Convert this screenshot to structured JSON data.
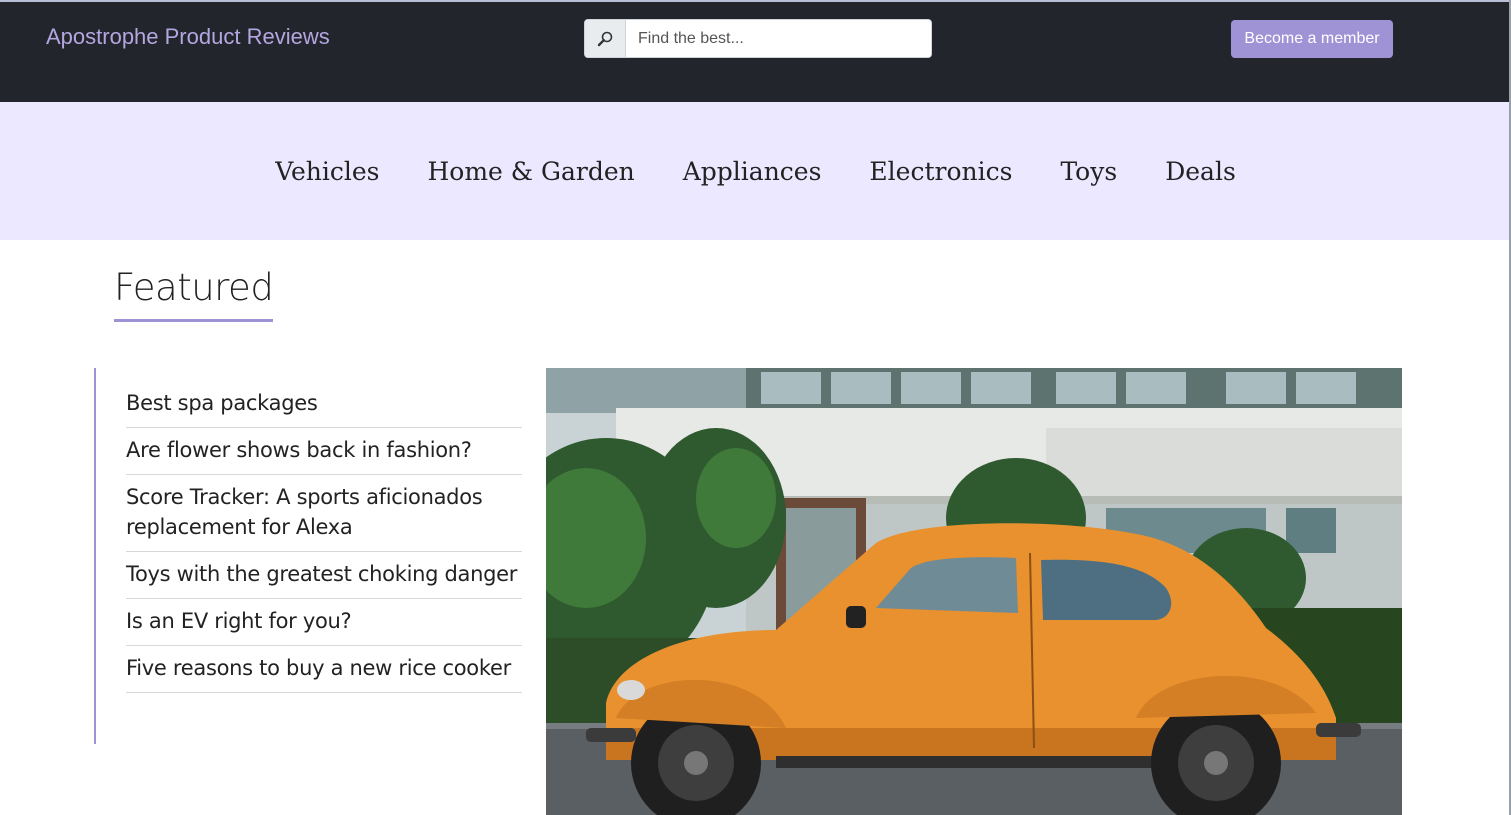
{
  "header": {
    "brand": "Apostrophe Product Reviews",
    "search": {
      "placeholder": "Find the best...",
      "value": "",
      "icon": "magnifier-icon"
    },
    "member_button": "Become a member"
  },
  "categories": [
    "Vehicles",
    "Home & Garden",
    "Appliances",
    "Electronics",
    "Toys",
    "Deals"
  ],
  "featured": {
    "title": "Featured",
    "articles": [
      "Best spa packages",
      "Are flower shows back in fashion?",
      "Score Tracker: A sports aficionados replacement for Alexa",
      "Toys with the greatest choking danger",
      "Is an EV right for you?",
      "Five reasons to buy a new rice cooker"
    ],
    "hero_image": "orange-vintage-beetle-car"
  },
  "colors": {
    "header_bg": "#22252b",
    "brand": "#b4a6e0",
    "accent": "#9f93d6",
    "nav_bg": "#ebe8ff",
    "car": "#e8912e"
  }
}
